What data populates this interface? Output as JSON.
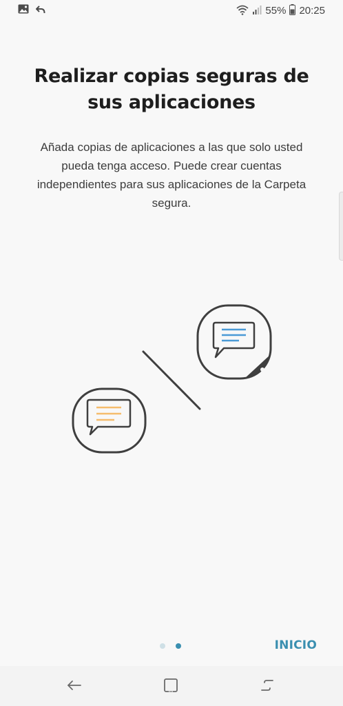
{
  "status_bar": {
    "left_icons": [
      "image-icon",
      "reply-icon"
    ],
    "battery_percent": "55%",
    "time": "20:25",
    "right_icons": [
      "wifi-icon",
      "signal-icon",
      "battery-icon"
    ]
  },
  "main": {
    "title": "Realizar copias seguras de sus aplicaciones",
    "description": "Añada copias de aplicaciones a las que solo usted pueda tenga acceso. Puede crear cuentas independientes para sus aplicaciones de la Carpeta segura."
  },
  "illustration": {
    "icons": [
      "chat-app-icon",
      "secure-chat-app-icon"
    ],
    "colors": {
      "outline": "#3f3f3f",
      "orange_lines": "#f5bc6c",
      "blue_lines": "#4a9ad6"
    }
  },
  "pager": {
    "current_page": 2,
    "total_pages": 2
  },
  "actions": {
    "start_label": "INICIO"
  },
  "colors": {
    "accent": "#3a8fb0",
    "background": "#f8f8f8"
  },
  "nav_bar": {
    "buttons": [
      "back-icon",
      "home-icon",
      "recents-icon"
    ]
  }
}
